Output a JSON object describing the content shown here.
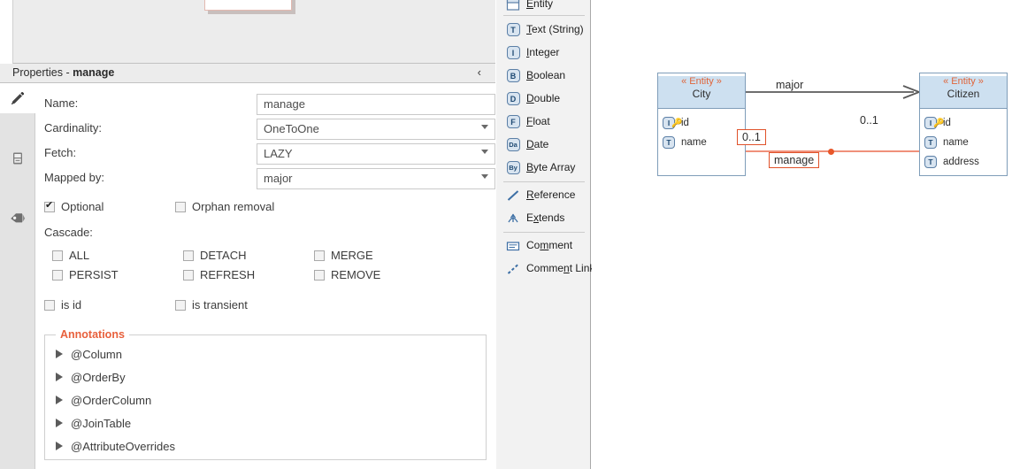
{
  "properties_panel": {
    "header": {
      "title_prefix": "Properties - ",
      "title_target": "manage",
      "collapse_icon": "‹"
    },
    "side_tabs": [
      {
        "name": "pencil-icon",
        "active": true
      },
      {
        "name": "database-icon",
        "active": false
      },
      {
        "name": "tag-icon",
        "active": false
      }
    ],
    "fields": [
      {
        "label": "Name:",
        "value": "manage",
        "type": "text"
      },
      {
        "label": "Cardinality:",
        "value": "OneToOne",
        "type": "select"
      },
      {
        "label": "Fetch:",
        "value": "LAZY",
        "type": "select"
      },
      {
        "label": "Mapped by:",
        "value": "major",
        "type": "select"
      }
    ],
    "flags": [
      {
        "label": "Optional",
        "checked": true
      },
      {
        "label": "Orphan removal",
        "checked": false
      }
    ],
    "cascade_label": "Cascade:",
    "cascade": [
      {
        "label": "ALL",
        "checked": false
      },
      {
        "label": "DETACH",
        "checked": false
      },
      {
        "label": "MERGE",
        "checked": false
      },
      {
        "label": "PERSIST",
        "checked": false
      },
      {
        "label": "REFRESH",
        "checked": false
      },
      {
        "label": "REMOVE",
        "checked": false
      }
    ],
    "id_flags": [
      {
        "label": "is id",
        "checked": false
      },
      {
        "label": "is transient",
        "checked": false
      }
    ],
    "annotations": {
      "legend": "Annotations",
      "legend_color": "#e8603c",
      "items": [
        {
          "label": "@Column"
        },
        {
          "label": "@OrderBy"
        },
        {
          "label": "@OrderColumn"
        },
        {
          "label": "@JoinTable"
        },
        {
          "label": "@AttributeOverrides"
        }
      ]
    }
  },
  "palette": {
    "items": [
      {
        "label": "Entity",
        "mnemonic": "E",
        "icon": "entity-icon",
        "badge": ""
      },
      {
        "label": "Text (String)",
        "mnemonic": "T",
        "icon": "text-string-icon",
        "badge": "T"
      },
      {
        "label": "Integer",
        "mnemonic": "I",
        "icon": "integer-icon",
        "badge": "I"
      },
      {
        "label": "Boolean",
        "mnemonic": "B",
        "icon": "boolean-icon",
        "badge": "B"
      },
      {
        "label": "Double",
        "mnemonic": "D",
        "icon": "double-icon",
        "badge": "D"
      },
      {
        "label": "Float",
        "mnemonic": "F",
        "icon": "float-icon",
        "badge": "F"
      },
      {
        "label": "Date",
        "mnemonic": "D",
        "icon": "date-icon",
        "badge": "Da"
      },
      {
        "label": "Byte Array",
        "mnemonic": "B",
        "icon": "byte-array-icon",
        "badge": "By"
      },
      {
        "label": "Reference",
        "mnemonic": "R",
        "icon": "reference-icon",
        "badge": ""
      },
      {
        "label": "Extends",
        "mnemonic": "x",
        "icon": "extends-icon",
        "badge": ""
      },
      {
        "label": "Comment",
        "mnemonic": "m",
        "icon": "comment-icon",
        "badge": ""
      },
      {
        "label": "Comment Link",
        "mnemonic": "n",
        "icon": "comment-link-icon",
        "badge": ""
      }
    ]
  },
  "diagram": {
    "entities": [
      {
        "stereotype": "« Entity »",
        "name": "City",
        "attributes": [
          {
            "name": "id",
            "type_badge": "I",
            "is_key": true
          },
          {
            "name": "name",
            "type_badge": "T",
            "is_key": false
          }
        ]
      },
      {
        "stereotype": "« Entity »",
        "name": "Citizen",
        "attributes": [
          {
            "name": "id",
            "type_badge": "I",
            "is_key": true
          },
          {
            "name": "name",
            "type_badge": "T",
            "is_key": false
          },
          {
            "name": "address",
            "type_badge": "T",
            "is_key": false
          }
        ]
      }
    ],
    "relations": [
      {
        "name": "major",
        "multiplicity": "0..1",
        "selected": false,
        "color": "#5a5a5a"
      },
      {
        "name": "manage",
        "multiplicity": "0..1",
        "selected": true,
        "color": "#f0907a",
        "selection_color": "#e0522a"
      }
    ]
  }
}
